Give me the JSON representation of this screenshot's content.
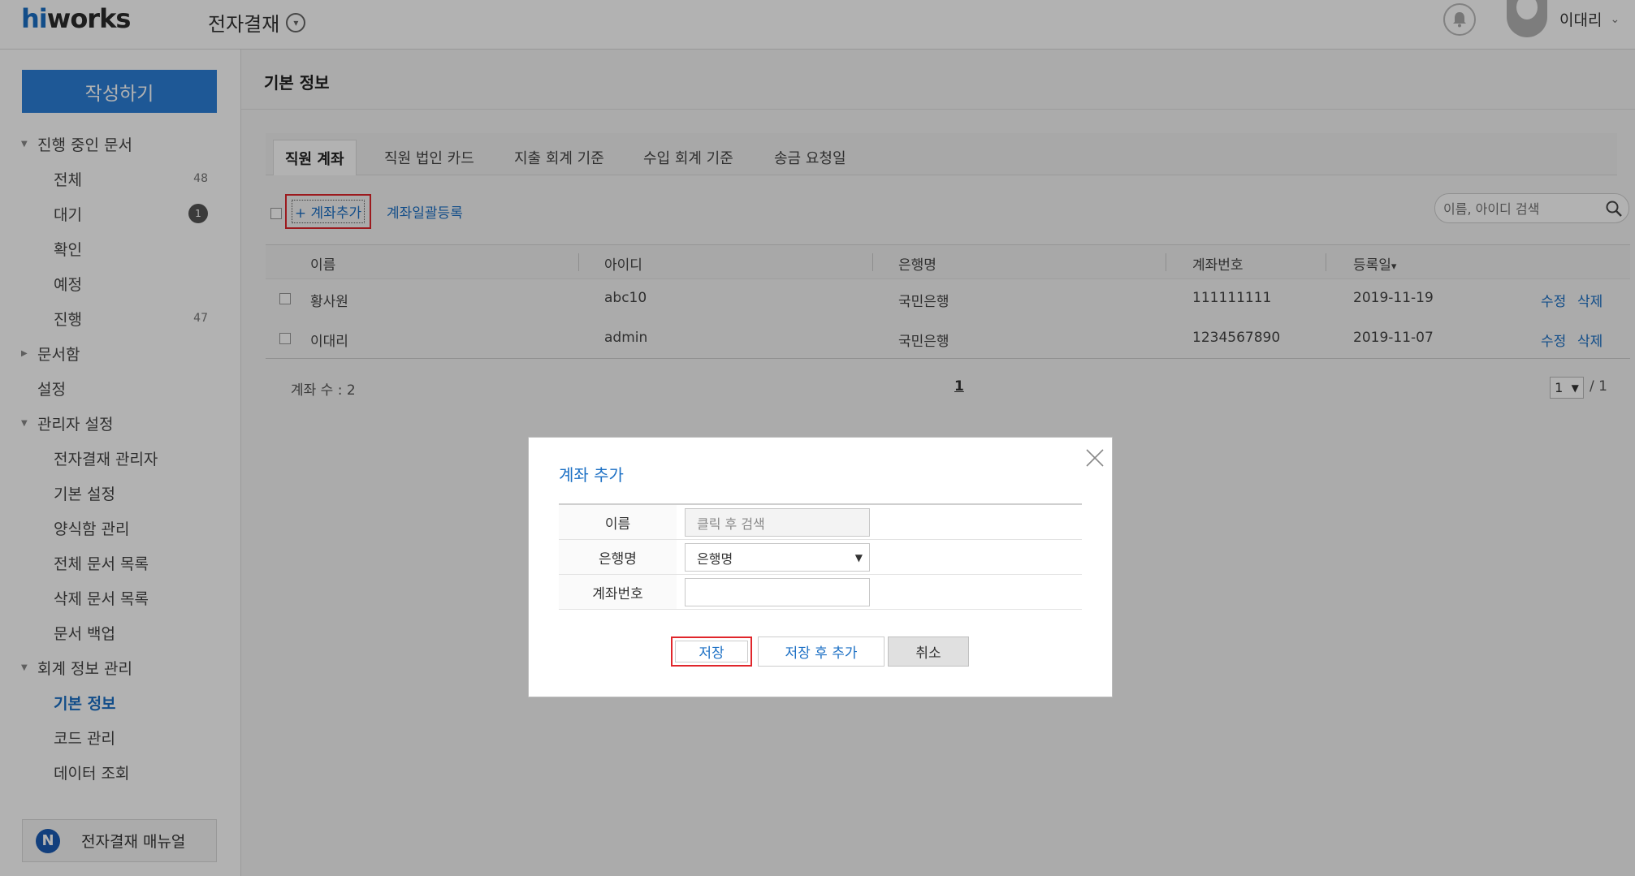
{
  "header": {
    "logo_hi": "hi",
    "logo_rest": "works",
    "app_title": "전자결재",
    "user_name": "이대리"
  },
  "sidebar": {
    "write_button": "작성하기",
    "items": [
      {
        "label": "진행 중인 문서",
        "level": 1,
        "expanded": true
      },
      {
        "label": "전체",
        "level": 2,
        "count": "48"
      },
      {
        "label": "대기",
        "level": 2,
        "badge": "1"
      },
      {
        "label": "확인",
        "level": 2
      },
      {
        "label": "예정",
        "level": 2
      },
      {
        "label": "진행",
        "level": 2,
        "count": "47"
      },
      {
        "label": "문서함",
        "level": 1,
        "expanded": false
      },
      {
        "label": "설정",
        "level": 1
      },
      {
        "label": "관리자 설정",
        "level": 1,
        "expanded": true
      },
      {
        "label": "전자결재 관리자",
        "level": 2
      },
      {
        "label": "기본 설정",
        "level": 2
      },
      {
        "label": "양식함 관리",
        "level": 2
      },
      {
        "label": "전체 문서 목록",
        "level": 2
      },
      {
        "label": "삭제 문서 목록",
        "level": 2
      },
      {
        "label": "문서 백업",
        "level": 2
      },
      {
        "label": "회계 정보 관리",
        "level": 1,
        "expanded": true
      },
      {
        "label": "기본 정보",
        "level": 2,
        "active": true
      },
      {
        "label": "코드 관리",
        "level": 2
      },
      {
        "label": "데이터 조회",
        "level": 2
      }
    ],
    "manual_icon": "N",
    "manual_button": "전자결재 매뉴얼"
  },
  "main": {
    "page_title": "기본 정보",
    "tabs": [
      {
        "label": "직원 계좌",
        "active": true
      },
      {
        "label": "직원 법인 카드"
      },
      {
        "label": "지출 회계 기준"
      },
      {
        "label": "수입 회계 기준"
      },
      {
        "label": "송금 요청일"
      }
    ],
    "add_account": "+ 계좌추가",
    "bulk_register": "계좌일괄등록",
    "search_placeholder": "이름, 아이디 검색",
    "table": {
      "headers": [
        "이름",
        "아이디",
        "은행명",
        "계좌번호",
        "등록일"
      ],
      "sort_indicator": "▾",
      "rows": [
        {
          "name": "황사원",
          "id": "abc10",
          "bank": "국민은행",
          "account": "111111111",
          "date": "2019-11-19",
          "edit": "수정",
          "delete": "삭제"
        },
        {
          "name": "이대리",
          "id": "admin",
          "bank": "국민은행",
          "account": "1234567890",
          "date": "2019-11-07",
          "edit": "수정",
          "delete": "삭제"
        }
      ]
    },
    "account_count": "계좌 수 : 2",
    "page_current": "1",
    "page_select": "1",
    "page_total": "/ 1"
  },
  "modal": {
    "title": "계좌 추가",
    "fields": [
      {
        "label": "이름",
        "placeholder": "클릭 후 검색"
      },
      {
        "label": "은행명",
        "value": "은행명"
      },
      {
        "label": "계좌번호",
        "value": ""
      }
    ],
    "buttons": {
      "save": "저장",
      "save_add": "저장 후 추가",
      "cancel": "취소"
    }
  },
  "colors": {
    "accent": "#1b6fc4",
    "primary_button": "#2b7fd7",
    "highlight_outline": "#e0262b"
  }
}
